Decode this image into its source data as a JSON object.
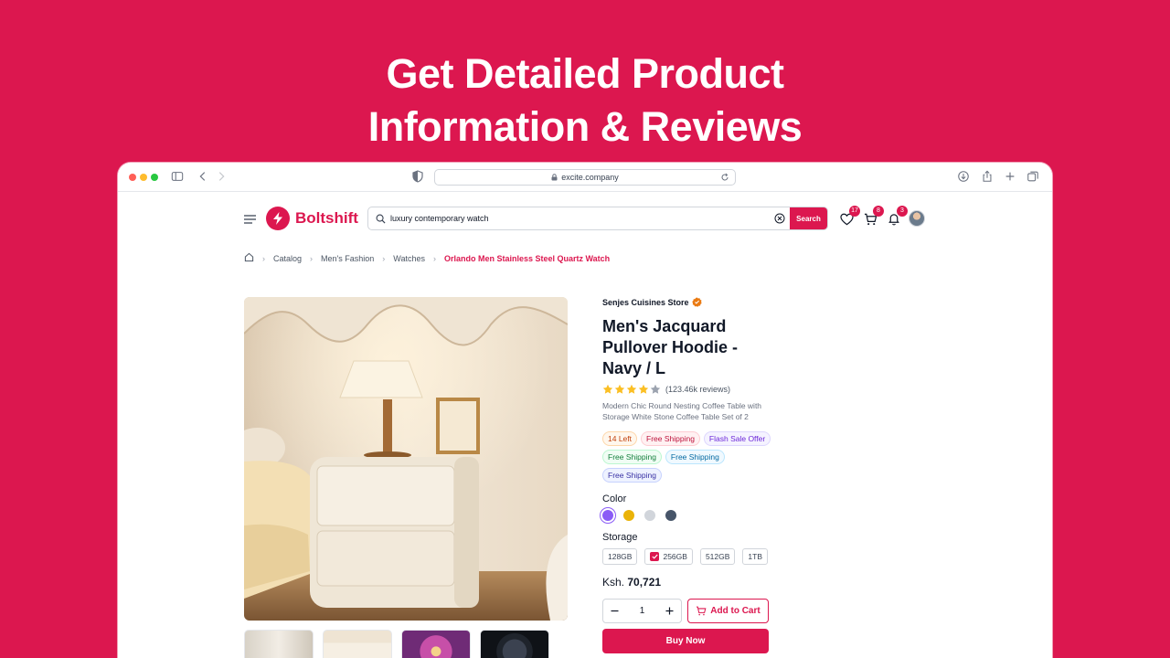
{
  "hero": {
    "line1": "Get Detailed Product",
    "line2": "Information & Reviews"
  },
  "browser": {
    "url": "excite.company"
  },
  "header": {
    "brand": "Boltshift",
    "search_value": "luxury contemporary watch",
    "search_button": "Search",
    "wishlist_count": "17",
    "cart_count": "8",
    "notifications_count": "3"
  },
  "breadcrumb": {
    "items": [
      "Catalog",
      "Men's Fashion",
      "Watches"
    ],
    "current": "Orlando Men Stainless Steel Quartz Watch"
  },
  "product": {
    "store": "Senjes Cuisines Store",
    "title": "Men's Jacquard Pullover Hoodie - Navy / L",
    "rating": 4,
    "reviews": "(123.46k reviews)",
    "description": "Modern Chic Round Nesting Coffee Table with Storage White Stone Coffee Table Set of 2",
    "tags": [
      {
        "label": "14 Left",
        "style": "orange"
      },
      {
        "label": "Free Shipping",
        "style": "pink"
      },
      {
        "label": "Flash Sale Offer",
        "style": "purple"
      },
      {
        "label": "Free Shipping",
        "style": "green"
      },
      {
        "label": "Free Shipping",
        "style": "blue"
      },
      {
        "label": "Free Shipping",
        "style": "indigo"
      }
    ],
    "color_label": "Color",
    "colors": [
      "#8b5cf6",
      "#eab308",
      "#d1d5db",
      "#475569"
    ],
    "storage_label": "Storage",
    "storage_options": [
      "128GB",
      "256GB",
      "512GB",
      "1TB"
    ],
    "storage_selected": "256GB",
    "currency": "Ksh.",
    "price": "70,721",
    "quantity": "1",
    "add_to_cart": "Add to Cart",
    "buy_now": "Buy Now"
  },
  "theme": {
    "accent": "#DC174F"
  }
}
